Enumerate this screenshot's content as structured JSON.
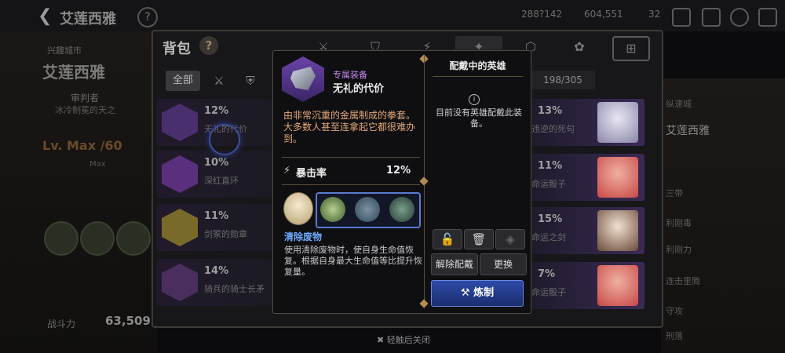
{
  "top_bar": {
    "back_title": "艾莲西雅",
    "help": "?",
    "resources": [
      "288?142",
      "604,551",
      "32"
    ]
  },
  "hero_panel": {
    "small_label": "兴趣城市",
    "name": "艾莲西雅",
    "sub1": "审判者",
    "sub2": "冰冷制冕的天之",
    "level": "Lv. Max /60",
    "max": "Max",
    "combat_label": "战斗力",
    "combat_value": "63,509"
  },
  "inventory": {
    "title": "背包",
    "help": "?",
    "filter_all": "全部",
    "count": "198/305",
    "rows_left": [
      {
        "stat": "12%",
        "name": "无礼的代价",
        "color": "#6b44a8"
      },
      {
        "stat": "10%",
        "name": "深红直环",
        "color": "#5a2f7e"
      },
      {
        "stat": "11%",
        "name": "剑冢的勋章",
        "color": "#7a6a2a"
      },
      {
        "stat": "14%",
        "name": "骑兵的骑士长矛",
        "color": "#4a2f5e"
      }
    ],
    "rows_right": [
      {
        "stat": "13%",
        "name": "违逆的死句",
        "color": "#a8a8c8"
      },
      {
        "stat": "11%",
        "name": "命运骰子",
        "color": "#c84848"
      },
      {
        "stat": "15%",
        "name": "命运之剑",
        "color": "#8a6a5a"
      },
      {
        "stat": "7%",
        "name": "命运骰子",
        "color": "#c84848"
      }
    ],
    "close_hint": "轻触后关闭"
  },
  "right_panel": {
    "name": "艾莲西雅",
    "lines": [
      "纵速城",
      "三带",
      "利刚毒",
      "利刚力",
      "连击里腾",
      "守攻",
      "刑落"
    ]
  },
  "popup": {
    "equip_type": "专属装备",
    "equip_name": "无礼的代价",
    "description": "由非常沉重的金属制成的拳套。大多数人甚至连拿起它都很难办到。",
    "stat_name": "暴击率",
    "stat_value": "12%",
    "skill_name": "清除废物",
    "skill_desc": "使用清除废物时，使自身生命值恢复。根据自身最大生命值等比提升恢复量。",
    "equipped_hero_title": "配戴中的英雄",
    "no_hero_text": "目前没有英雄配戴此装备。",
    "btn_unequip": "解除配戴",
    "btn_replace": "更换",
    "btn_forge": "炼制",
    "colors": {
      "accent_blue": "#2e4aa8",
      "desc_orange": "#e3a876",
      "skill_blue": "#6fa9ff"
    }
  }
}
